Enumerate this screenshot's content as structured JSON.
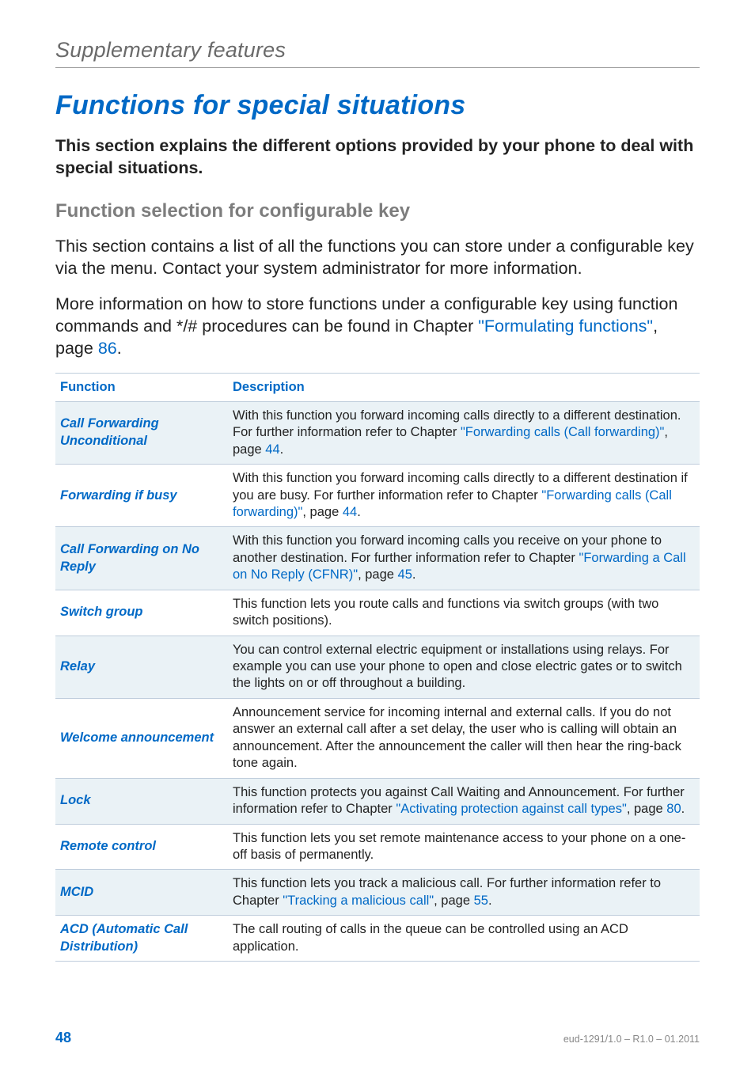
{
  "chapter": "Supplementary features",
  "title": "Functions for special situations",
  "intro": "This section explains the different options provided by your phone to deal with special situations.",
  "section": "Function selection for configurable key",
  "para1": "This section contains a list of all the functions you can store under a configurable key via the menu. Contact your system administrator for more information.",
  "para2_a": "More information on how to store functions under a configurable key using function commands and */# procedures can be found in Chapter ",
  "para2_link": "\"Formulating functions\"",
  "para2_b": ", page ",
  "para2_page": "86",
  "para2_c": ".",
  "table": {
    "headers": {
      "function": "Function",
      "description": "Description"
    },
    "rows": [
      {
        "fn": "Call Forwarding Unconditional",
        "desc_a": "With this function you forward incoming calls directly to a different destination. For further information refer to Chapter ",
        "link": "\"Forwarding calls (Call forwarding)\"",
        "desc_b": ", page ",
        "page": "44",
        "desc_c": ".",
        "shade": true
      },
      {
        "fn": "Forwarding if busy",
        "desc_a": "With this function you forward incoming calls directly to a different destination if you are busy. For further information refer to Chapter ",
        "link": "\"Forwarding calls (Call forwarding)\"",
        "desc_b": ", page ",
        "page": "44",
        "desc_c": ".",
        "shade": false
      },
      {
        "fn": "Call Forwarding on No Reply",
        "desc_a": "With this function you forward incoming calls you receive on your phone to another destination. For further information refer to Chapter ",
        "link": "\"Forwarding a Call on No Reply (CFNR)\"",
        "desc_b": ", page ",
        "page": "45",
        "desc_c": ".",
        "shade": true
      },
      {
        "fn": "Switch group",
        "desc_a": "This function lets you route calls and functions via switch groups (with two switch positions).",
        "link": "",
        "desc_b": "",
        "page": "",
        "desc_c": "",
        "shade": false
      },
      {
        "fn": "Relay",
        "desc_a": "You can control external electric equipment or installations using relays. For example you can use your phone to open and close electric gates or to switch the lights on or off throughout a building.",
        "link": "",
        "desc_b": "",
        "page": "",
        "desc_c": "",
        "shade": true
      },
      {
        "fn": "Welcome announcement",
        "desc_a": "Announcement service for incoming internal and external calls. If you do not answer an external call after a set delay, the user who is calling will obtain an announcement. After the announcement the caller will then hear the ring-back tone again.",
        "link": "",
        "desc_b": "",
        "page": "",
        "desc_c": "",
        "shade": false
      },
      {
        "fn": "Lock",
        "desc_a": "This function protects you against Call Waiting and Announcement. For further information refer to Chapter ",
        "link": "\"Activating protection against call types\"",
        "desc_b": ", page ",
        "page": "80",
        "desc_c": ".",
        "shade": true
      },
      {
        "fn": "Remote control",
        "desc_a": "This function lets you set remote maintenance access to your phone on a one-off basis of permanently.",
        "link": "",
        "desc_b": "",
        "page": "",
        "desc_c": "",
        "shade": false
      },
      {
        "fn": "MCID",
        "desc_a": "This function lets you track a malicious call. For further information refer to Chapter ",
        "link": "\"Tracking a malicious call\"",
        "desc_b": ", page ",
        "page": "55",
        "desc_c": ".",
        "shade": true
      },
      {
        "fn": "ACD (Automatic Call Distribution)",
        "desc_a": "The call routing of calls in the queue can be controlled using an ACD application.",
        "link": "",
        "desc_b": "",
        "page": "",
        "desc_c": "",
        "shade": false
      }
    ]
  },
  "footer": {
    "page": "48",
    "doc": "eud-1291/1.0 – R1.0 – 01.2011"
  }
}
